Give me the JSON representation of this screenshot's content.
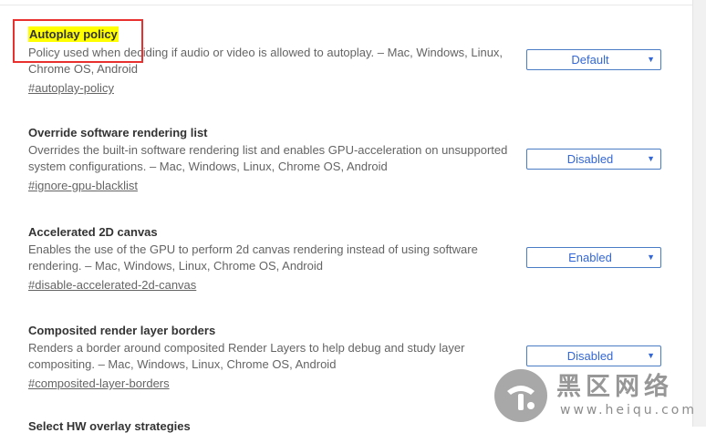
{
  "flags": [
    {
      "title": "Autoplay policy",
      "description": "Policy used when deciding if audio or video is allowed to autoplay. – Mac, Windows, Linux, Chrome OS, Android",
      "link": "#autoplay-policy",
      "selected": "Default"
    },
    {
      "title": "Override software rendering list",
      "description": "Overrides the built-in software rendering list and enables GPU-acceleration on unsupported system configurations. – Mac, Windows, Linux, Chrome OS, Android",
      "link": "#ignore-gpu-blacklist",
      "selected": "Disabled"
    },
    {
      "title": "Accelerated 2D canvas",
      "description": "Enables the use of the GPU to perform 2d canvas rendering instead of using software rendering. – Mac, Windows, Linux, Chrome OS, Android",
      "link": "#disable-accelerated-2d-canvas",
      "selected": "Enabled"
    },
    {
      "title": "Composited render layer borders",
      "description": "Renders a border around composited Render Layers to help debug and study layer compositing. – Mac, Windows, Linux, Chrome OS, Android",
      "link": "#composited-layer-borders",
      "selected": "Disabled"
    }
  ],
  "next_flag_partial_title": "Select HW overlay strategies",
  "watermark": {
    "text": "黑区网络",
    "url": "www.heiqu.com"
  },
  "colors": {
    "highlight": "#ffff00",
    "annotation_box": "#e8312f",
    "select_text": "#3367d6"
  },
  "icons": {
    "select_caret": "caret-down-icon"
  }
}
